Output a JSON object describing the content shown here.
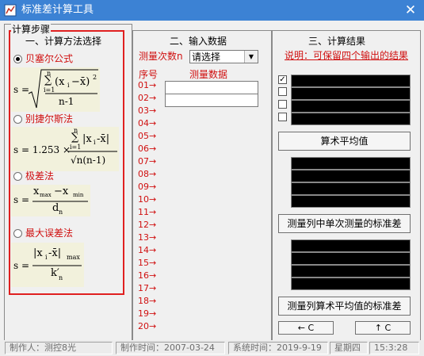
{
  "window": {
    "title": "标准差计算工具",
    "close_glyph": "✕"
  },
  "colors": {
    "titlebar": "#3c82d4",
    "accent_red": "#d01010",
    "highlight_border": "#e02020"
  },
  "steps": {
    "legend": "计算步骤",
    "section_title": "一、计算方法选择",
    "methods": [
      {
        "label": "贝塞尔公式",
        "selected": true
      },
      {
        "label": "别捷尔斯法",
        "selected": false
      },
      {
        "label": "极差法",
        "selected": false
      },
      {
        "label": "最大误差法",
        "selected": false
      }
    ],
    "formulas": {
      "bessel": {
        "lhs": "s =",
        "sum_top": "n",
        "sum_bottom": "i=1",
        "body": "(x",
        "sub": "i",
        "minus": "−x̄)",
        "sup": "2",
        "denom": "n-1"
      },
      "peters": {
        "lhs": "s = 1.253 ×",
        "sum_top": "n",
        "sum_bottom": "i=1",
        "numer": "|x",
        "sub": "i",
        "minus": "-x̄|",
        "denom": "√n(n-1)"
      },
      "range": {
        "lhs": "s =",
        "numer_a": "x",
        "sub_a": "max",
        "mid": "−x",
        "sub_b": "min",
        "denom": "d",
        "denom_sub": "n"
      },
      "maxerr": {
        "lhs": "s =",
        "numer": "|x",
        "sub": "i",
        "minus": "-x̄|",
        "numer_sub": "max",
        "denom": "k′",
        "denom_sub": "n"
      }
    }
  },
  "input": {
    "section_title": "二、输入数据",
    "count_label": "测量次数n",
    "select_value": "请选择",
    "seq_label": "序号",
    "data_label": "测量数据",
    "rows": [
      "01→",
      "02→",
      "03→",
      "04→",
      "05→",
      "06→",
      "07→",
      "08→",
      "09→",
      "10→",
      "11→",
      "12→",
      "13→",
      "14→",
      "15→",
      "16→",
      "17→",
      "18→",
      "19→",
      "20→"
    ]
  },
  "results": {
    "section_title": "三、计算结果",
    "note": "说明：可保留四个输出的结果",
    "checks": [
      true,
      false,
      false,
      false
    ],
    "check_mark": "✓",
    "btn_mean": "算术平均值",
    "btn_single_std": "测量列中单次测量的标准差",
    "btn_mean_std": "测量列算术平均值的标准差",
    "btn_left": "← C",
    "btn_up": "↑ C"
  },
  "status": {
    "author": "制作人：测控8光",
    "made": "制作时间：2007-03-24",
    "sys": "系统时间：2019-9-19",
    "weekday": "星期四",
    "time": "15:3:28"
  }
}
